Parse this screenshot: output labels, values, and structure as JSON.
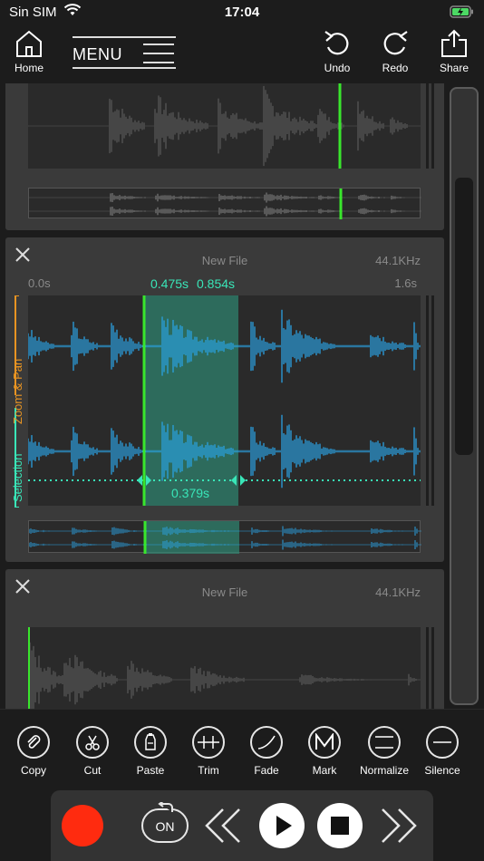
{
  "status": {
    "carrier": "Sin SIM",
    "time": "17:04"
  },
  "toolbar": {
    "home_label": "Home",
    "menu_label": "MENU",
    "undo_label": "Undo",
    "redo_label": "Redo",
    "share_label": "Share"
  },
  "tracks": [
    {
      "filename": "",
      "rate": ""
    },
    {
      "filename": "New File",
      "rate": "44.1KHz",
      "time_start": "0.0s",
      "time_end": "1.6s",
      "selection_start": "0.475s",
      "selection_end": "0.854s",
      "selection_length": "0.379s",
      "side_zoom_label": "Zoom & Pan",
      "side_selection_label": "Selection"
    },
    {
      "filename": "New File",
      "rate": "44.1KHz"
    }
  ],
  "edit_tools": [
    {
      "label": "Copy",
      "icon": "paperclip-icon"
    },
    {
      "label": "Cut",
      "icon": "scissors-icon"
    },
    {
      "label": "Paste",
      "icon": "paste-icon"
    },
    {
      "label": "Trim",
      "icon": "trim-icon"
    },
    {
      "label": "Fade",
      "icon": "fade-curve-icon"
    },
    {
      "label": "Mark",
      "icon": "mark-m-icon"
    },
    {
      "label": "Normalize",
      "icon": "normalize-icon"
    },
    {
      "label": "Silence",
      "icon": "silence-icon"
    }
  ],
  "transport": {
    "on_label": "ON"
  },
  "colors": {
    "accent_green": "#39e62c",
    "selection_teal": "#39e6b8",
    "waveform_blue": "#2aa0e0",
    "zoom_orange": "#e89422",
    "record_red": "#ff2b0f"
  }
}
